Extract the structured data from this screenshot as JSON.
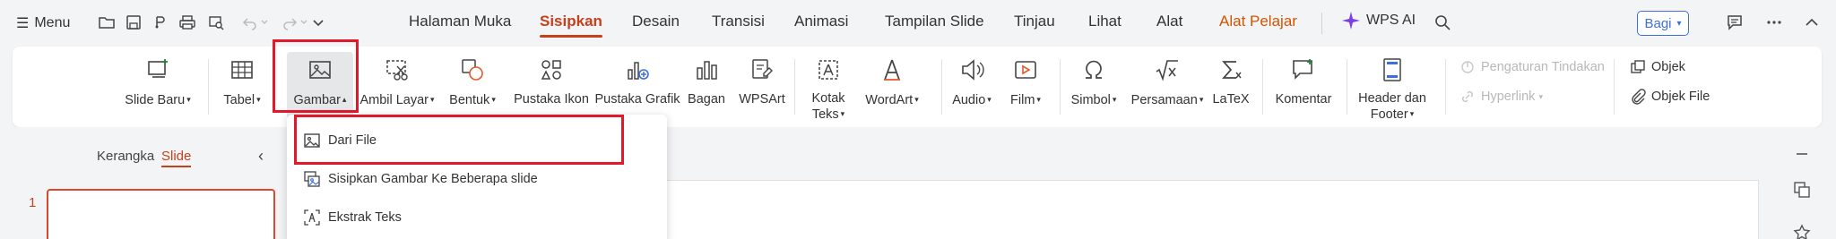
{
  "topbar": {
    "menu_label": "Menu",
    "tabs": [
      {
        "label": "Halaman Muka"
      },
      {
        "label": "Sisipkan"
      },
      {
        "label": "Desain"
      },
      {
        "label": "Transisi"
      },
      {
        "label": "Animasi"
      },
      {
        "label": "Tampilan Slide"
      },
      {
        "label": "Tinjau"
      },
      {
        "label": "Lihat"
      },
      {
        "label": "Alat"
      },
      {
        "label": "Alat Pelajar"
      }
    ],
    "active_tab": "Sisipkan",
    "wps_ai_label": "WPS AI",
    "share_label": "Bagi"
  },
  "ribbon": {
    "slide_baru": "Slide Baru",
    "tabel": "Tabel",
    "gambar": "Gambar",
    "ambil_layar": "Ambil Layar",
    "bentuk": "Bentuk",
    "pustaka_ikon": "Pustaka Ikon",
    "pustaka_grafik": "Pustaka Grafik",
    "bagan": "Bagan",
    "wpsart": "WPSArt",
    "kotak_teks_1": "Kotak",
    "kotak_teks_2": "Teks",
    "wordart": "WordArt",
    "audio": "Audio",
    "film": "Film",
    "simbol": "Simbol",
    "persamaan": "Persamaan",
    "latex": "LaTeX",
    "komentar": "Komentar",
    "header_footer_1": "Header dan",
    "header_footer_2": "Footer",
    "pengaturan_tindakan": "Pengaturan Tindakan",
    "hyperlink": "Hyperlink",
    "objek": "Objek",
    "objek_file": "Objek File"
  },
  "panel": {
    "kerangka": "Kerangka",
    "slide": "Slide",
    "slide_number": "1"
  },
  "dropdown": {
    "items": [
      {
        "label": "Dari File"
      },
      {
        "label": "Sisipkan Gambar Ke Beberapa slide"
      },
      {
        "label": "Ekstrak Teks"
      }
    ]
  },
  "colors": {
    "accent": "#c5411d",
    "highlight": "#e0192b",
    "share": "#3d6ee0",
    "ai": "#7b3fe4"
  }
}
